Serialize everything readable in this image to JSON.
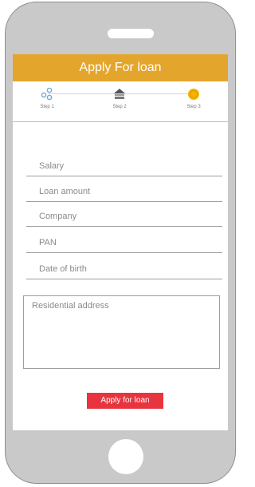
{
  "header": {
    "title": "Apply For loan"
  },
  "steps": [
    {
      "label": "Step 1",
      "icon": "connected-circles-icon"
    },
    {
      "label": "Step 2",
      "icon": "bank-icon"
    },
    {
      "label": "Step 3",
      "icon": "gold-coin-icon"
    }
  ],
  "form": {
    "salary_placeholder": "Salary",
    "loan_amount_placeholder": "Loan amount",
    "company_placeholder": "Company",
    "pan_placeholder": "PAN",
    "dob_placeholder": "Date of birth",
    "address_placeholder": "Residential address",
    "submit_label": "Apply for loan"
  },
  "colors": {
    "header": "#e4a52c",
    "button": "#e8343f",
    "phone_body": "#c9c9c9"
  }
}
